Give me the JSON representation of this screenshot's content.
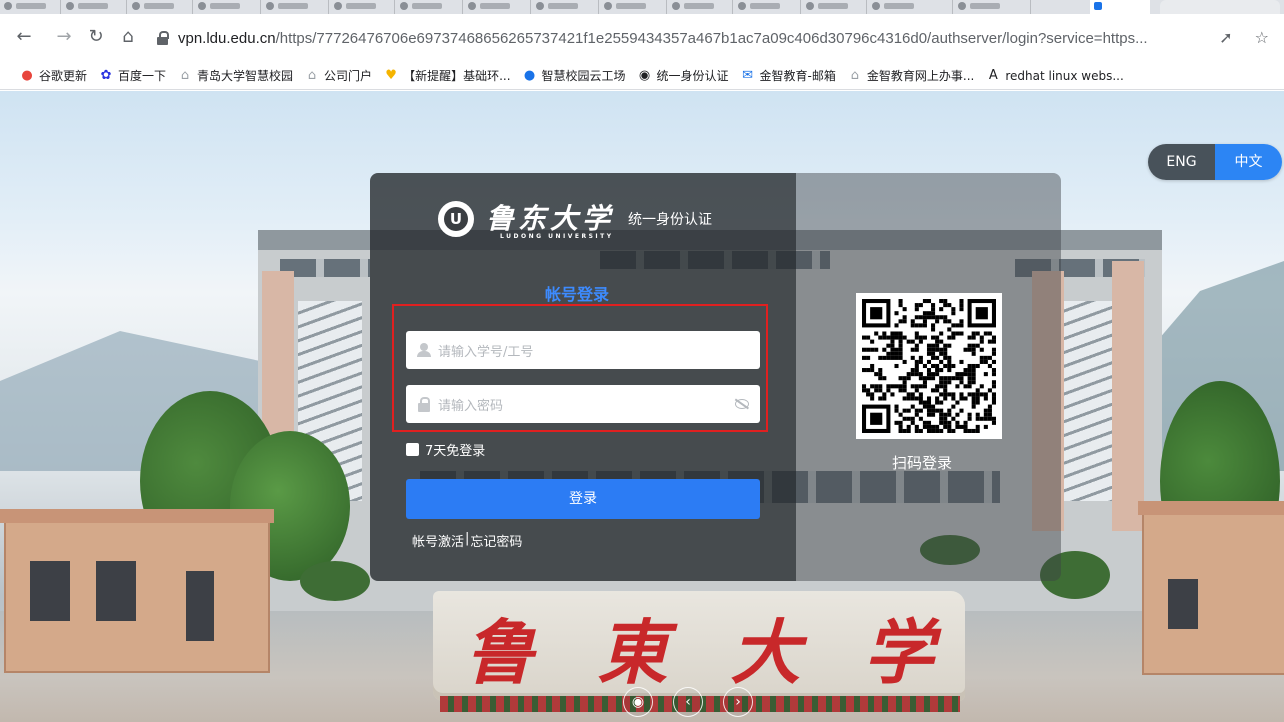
{
  "browser": {
    "url_host": "vpn.ldu.edu.cn",
    "url_path": "/https/77726476706e69737468656265737421f1e2559434357a467b1ac7a09c406d30796c4316d0/authserver/login?service=https...",
    "bookmarks": [
      {
        "label": "谷歌更新",
        "icon": "chrome-icon",
        "color": "#e8453c"
      },
      {
        "label": "百度一下",
        "icon": "baidu-paw-icon",
        "color": "#2932e1"
      },
      {
        "label": "青岛大学智慧校园",
        "icon": "home-icon",
        "color": "#9aa0a6"
      },
      {
        "label": "公司门户",
        "icon": "home-icon",
        "color": "#9aa0a6"
      },
      {
        "label": "【新提醒】基础环...",
        "icon": "heart-icon",
        "color": "#f5b400"
      },
      {
        "label": "智慧校园云工场",
        "icon": "cloud-icon",
        "color": "#1a73e8"
      },
      {
        "label": "统一身份认证",
        "icon": "globe-icon",
        "color": "#202124"
      },
      {
        "label": "金智教育-邮箱",
        "icon": "mail-icon",
        "color": "#1a73e8"
      },
      {
        "label": "金智教育网上办事...",
        "icon": "home-icon",
        "color": "#9aa0a6"
      },
      {
        "label": "redhat linux webs...",
        "icon": "redhat-icon",
        "color": "#202124"
      }
    ]
  },
  "lang": {
    "eng": "ENG",
    "zh": "中文"
  },
  "login": {
    "university_cn": "鲁东大学",
    "university_en": "LUDONG UNIVERSITY",
    "subtitle": "统一身份认证",
    "tab_title": "帐号登录",
    "username_placeholder": "请输入学号/工号",
    "password_placeholder": "请输入密码",
    "remember_label": "7天免登录",
    "submit_label": "登录",
    "activate_link": "帐号激活",
    "separator": "|",
    "forgot_link": "忘记密码",
    "qr_label": "扫码登录"
  },
  "scene": {
    "stone_chars": [
      "鲁",
      "東",
      "大",
      "学"
    ]
  },
  "carousel": {
    "wechat_icon": "wechat-icon",
    "prev": "‹",
    "next": "›"
  }
}
